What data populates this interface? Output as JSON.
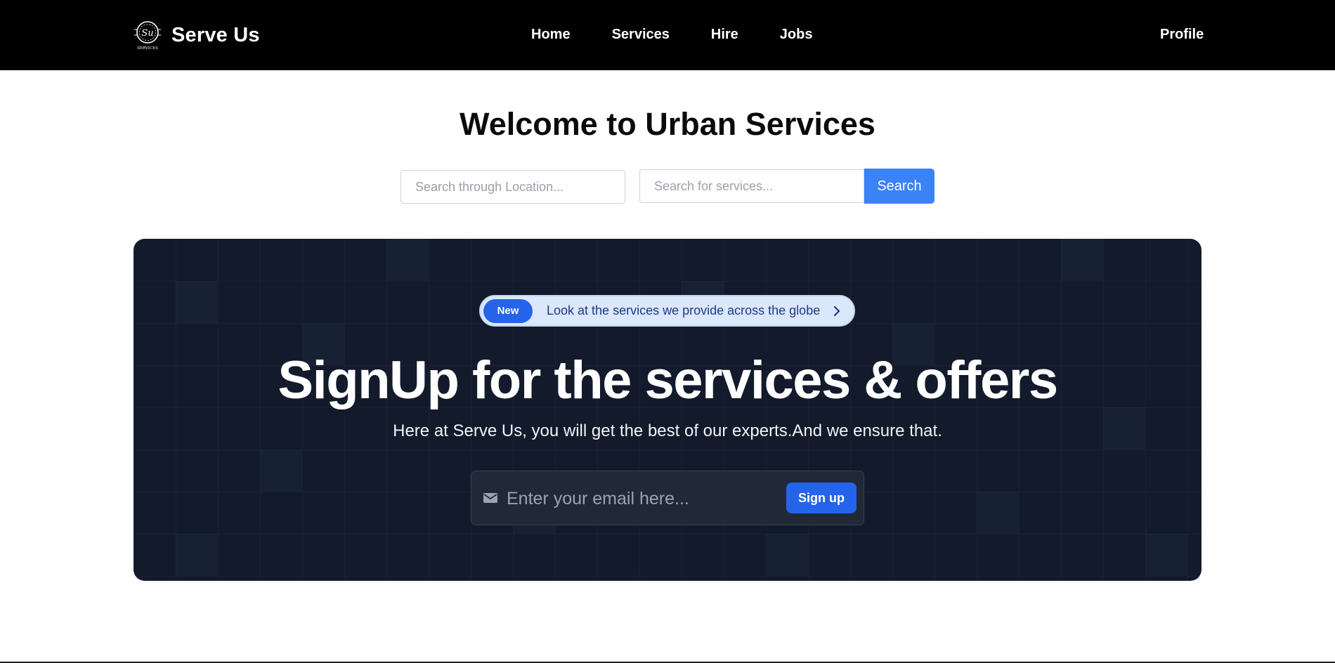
{
  "header": {
    "brand_name": "Serve Us",
    "logo_text": "Su",
    "logo_caption": "SERVICES",
    "nav": [
      {
        "label": "Home"
      },
      {
        "label": "Services"
      },
      {
        "label": "Hire"
      },
      {
        "label": "Jobs"
      }
    ],
    "profile_label": "Profile"
  },
  "welcome": {
    "title": "Welcome to Urban Services",
    "location_placeholder": "Search through Location...",
    "services_placeholder": "Search for services...",
    "search_label": "Search"
  },
  "hero": {
    "badge": "New",
    "announcement": "Look at the services we provide across the globe",
    "title": "SignUp for the services & offers",
    "subtitle": "Here at Serve Us, you will get the best of our experts.And we ensure that.",
    "email_placeholder": "Enter your email here...",
    "signup_label": "Sign up"
  },
  "colors": {
    "navbar_bg": "#000000",
    "search_button": "#3b82f6",
    "hero_bg": "#121a2b",
    "badge_bg": "#2563eb",
    "pill_bg": "#dbe7fb",
    "signup_button": "#2563eb"
  },
  "icons": {
    "logo": "su-services-logo",
    "pill_arrow": "chevron-right-icon",
    "email": "mail-icon"
  }
}
